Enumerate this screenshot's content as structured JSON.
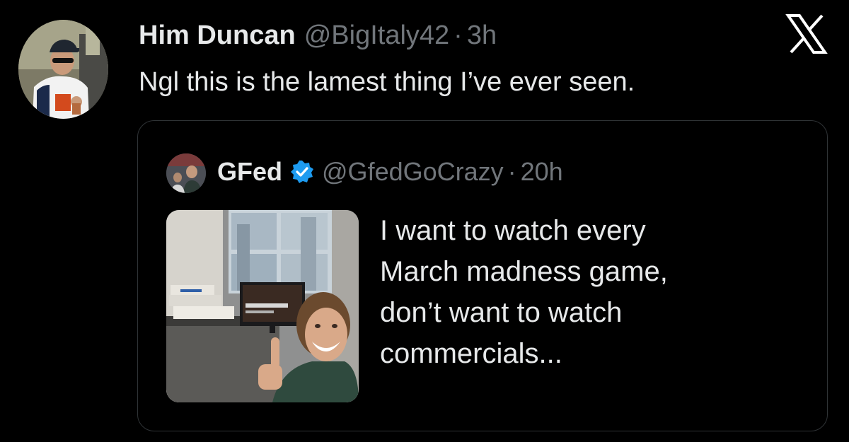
{
  "tweet": {
    "display_name": "Him Duncan",
    "handle": "@BigItaly42",
    "separator": "·",
    "time": "3h",
    "text": "Ngl this is the lamest thing I’ve ever seen.",
    "avatar_icon": "profile-photo-man-in-cap",
    "platform_icon": "x-logo-icon"
  },
  "quote": {
    "display_name": "GFed",
    "verified_icon": "verified-badge-icon",
    "verified_color": "#1d9bf0",
    "handle": "@GfedGoCrazy",
    "separator": "·",
    "time": "20h",
    "text_lines": [
      "I want to watch every",
      "March madness game,",
      "don’t want to watch",
      "commercials..."
    ],
    "media_icon": "photo-man-thumbs-up-with-tv-monitors"
  },
  "colors": {
    "background": "#000000",
    "primary_text": "#e7e9ea",
    "secondary_text": "#71767b",
    "card_border": "#2f3336"
  }
}
